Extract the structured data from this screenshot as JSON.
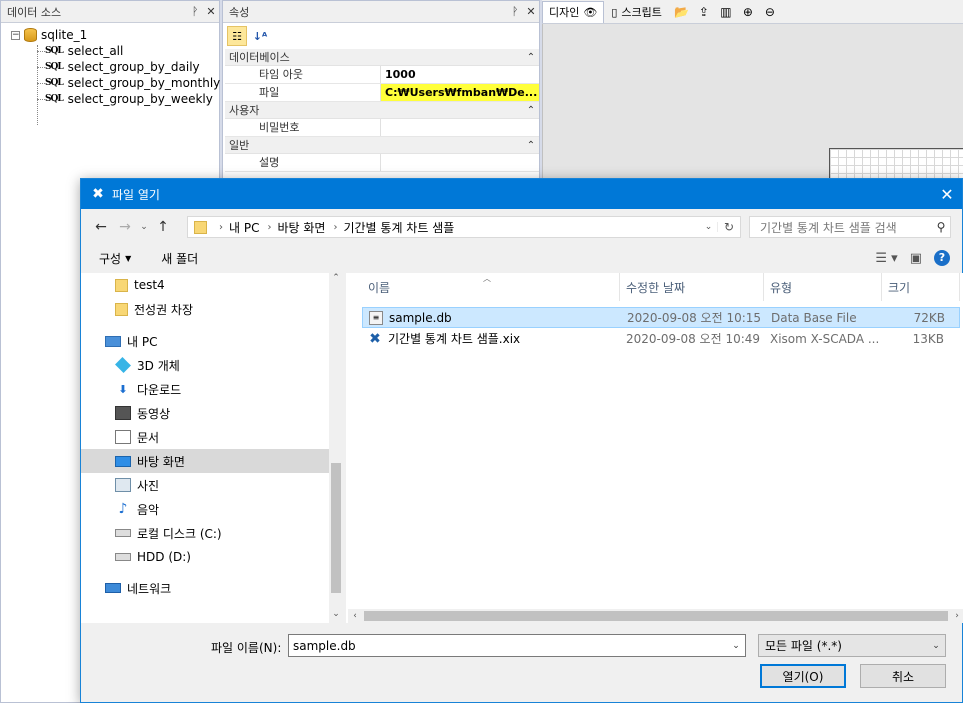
{
  "ds_panel": {
    "title": "데이터 소스",
    "pin": "ᵖ",
    "close": "✕",
    "root": "sqlite_1",
    "queries": [
      "select_all",
      "select_group_by_daily",
      "select_group_by_monthly",
      "select_group_by_weekly"
    ],
    "sql_icon": "SQL"
  },
  "prop_panel": {
    "title": "속성",
    "pin": "ᵖ",
    "close": "✕",
    "categories": [
      {
        "name": "데이터베이스",
        "rows": [
          {
            "key": "타임 아웃",
            "value": "1000"
          },
          {
            "key": "파일",
            "value": "C:₩Users₩fmban₩De..."
          }
        ]
      },
      {
        "name": "사용자",
        "rows": [
          {
            "key": "비밀번호",
            "value": ""
          }
        ]
      },
      {
        "name": "일반",
        "rows": [
          {
            "key": "설명",
            "value": ""
          }
        ]
      }
    ]
  },
  "design": {
    "tab_design": "디자인",
    "tab_script": "스크립트"
  },
  "dialog": {
    "title": "파일 열기",
    "breadcrumb": [
      "내 PC",
      "바탕 화면",
      "기간별  통계 차트 샘플"
    ],
    "search_placeholder": "기간별  통계 차트 샘플 검색",
    "organize": "구성",
    "new_folder": "새 폴더",
    "nav_items": [
      {
        "label": "test4",
        "icon": "folder-icon",
        "indent": 1
      },
      {
        "label": "전성권 차장",
        "icon": "folder-icon",
        "indent": 1
      },
      {
        "label": "내 PC",
        "icon": "pc-icon",
        "indent": 0
      },
      {
        "label": "3D 개체",
        "icon": "3d-objects-icon",
        "indent": 1
      },
      {
        "label": "다운로드",
        "icon": "download-icon",
        "indent": 1
      },
      {
        "label": "동영상",
        "icon": "video-icon",
        "indent": 1
      },
      {
        "label": "문서",
        "icon": "document-icon",
        "indent": 1
      },
      {
        "label": "바탕 화면",
        "icon": "desktop-icon",
        "indent": 1,
        "selected": true
      },
      {
        "label": "사진",
        "icon": "picture-icon",
        "indent": 1
      },
      {
        "label": "음악",
        "icon": "music-icon",
        "indent": 1
      },
      {
        "label": "로컬 디스크 (C:)",
        "icon": "local-disk-icon",
        "indent": 1
      },
      {
        "label": "HDD (D:)",
        "icon": "hdd-icon",
        "indent": 1
      },
      {
        "label": "네트워크",
        "icon": "network-icon",
        "indent": 0
      }
    ],
    "columns": {
      "name": "이름",
      "date": "수정한 날짜",
      "type": "유형",
      "size": "크기"
    },
    "files": [
      {
        "name": "sample.db",
        "date": "2020-09-08 오전 10:15",
        "type": "Data Base File",
        "size": "72KB",
        "icon": "db-file-icon",
        "selected": true
      },
      {
        "name": "기간별 통계 차트 샘플.xix",
        "date": "2020-09-08 오전 10:49",
        "type": "Xisom X-SCADA ...",
        "size": "13KB",
        "icon": "xscada-file-icon",
        "selected": false
      }
    ],
    "filename_label": "파일 이름(N):",
    "filename_value": "sample.db",
    "filter_value": "모든 파일 (*.*)",
    "open_label": "열기(O)",
    "cancel_label": "취소"
  }
}
